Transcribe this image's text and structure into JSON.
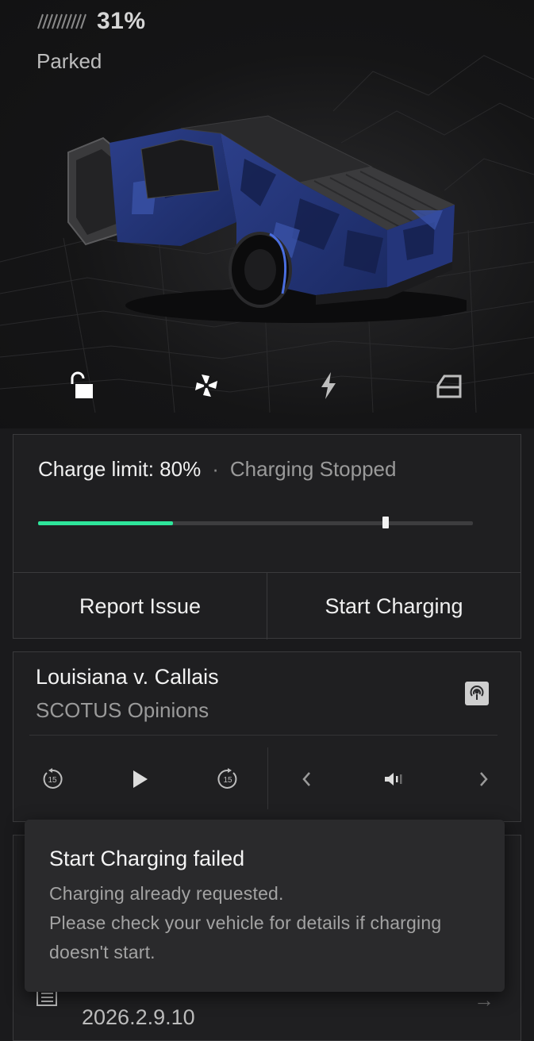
{
  "header": {
    "battery_percent": "31%",
    "battery_level": 0.31,
    "vehicle_status": "Parked"
  },
  "quick_controls": [
    {
      "icon": "unlock-icon"
    },
    {
      "icon": "fan-icon"
    },
    {
      "icon": "lightning-icon"
    },
    {
      "icon": "frunk-icon"
    }
  ],
  "charging": {
    "limit_text": "Charge limit: 80%",
    "separator": "·",
    "status_text": "Charging Stopped",
    "current_level": 0.31,
    "limit_level": 0.8,
    "fill_color": "#2ee59b",
    "report_issue_label": "Report Issue",
    "start_charging_label": "Start Charging"
  },
  "media": {
    "title": "Louisiana v. Callais",
    "subtitle": "SCOTUS Opinions",
    "rewind_label": "15",
    "forward_label": "15"
  },
  "release": {
    "version": "2026.2.9.10"
  },
  "toast": {
    "title": "Start Charging failed",
    "lines": [
      "Charging already requested.",
      "Please check your vehicle for details if charging",
      "doesn't start."
    ]
  }
}
